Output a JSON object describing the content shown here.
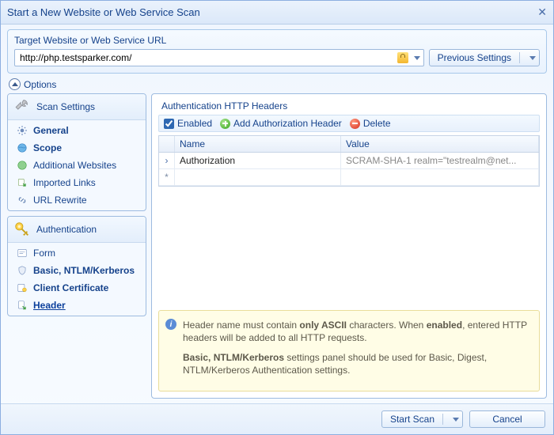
{
  "title": "Start a New Website or Web Service Scan",
  "url_section": {
    "label": "Target Website or Web Service URL",
    "value": "http://php.testsparker.com/",
    "previous_btn": "Previous Settings"
  },
  "options_label": "Options",
  "sidebar": {
    "scan": {
      "header": "Scan Settings",
      "items": [
        {
          "label": "General",
          "bold": true
        },
        {
          "label": "Scope",
          "bold": true
        },
        {
          "label": "Additional Websites",
          "bold": false
        },
        {
          "label": "Imported Links",
          "bold": false
        },
        {
          "label": "URL Rewrite",
          "bold": false
        }
      ]
    },
    "auth": {
      "header": "Authentication",
      "items": [
        {
          "label": "Form",
          "bold": false
        },
        {
          "label": "Basic, NTLM/Kerberos",
          "bold": true
        },
        {
          "label": "Client Certificate",
          "bold": true
        },
        {
          "label": "Header",
          "bold": true,
          "active": true
        }
      ]
    }
  },
  "main": {
    "section_title": "Authentication HTTP Headers",
    "enabled_label": "Enabled",
    "add_label": "Add Authorization Header",
    "delete_label": "Delete",
    "columns": {
      "name": "Name",
      "value": "Value"
    },
    "rows": [
      {
        "name": "Authorization",
        "value": "SCRAM-SHA-1 realm=\"testrealm@net..."
      }
    ],
    "info_p1_a": "Header name must contain ",
    "info_p1_b": "only ASCII",
    "info_p1_c": " characters. When ",
    "info_p1_d": "enabled",
    "info_p1_e": ", entered HTTP headers will be added to all HTTP requests.",
    "info_p2_a": "Basic, NTLM/Kerberos",
    "info_p2_b": " settings panel should be used for Basic, Digest, NTLM/Kerberos Authentication settings."
  },
  "footer": {
    "start": "Start Scan",
    "cancel": "Cancel"
  }
}
